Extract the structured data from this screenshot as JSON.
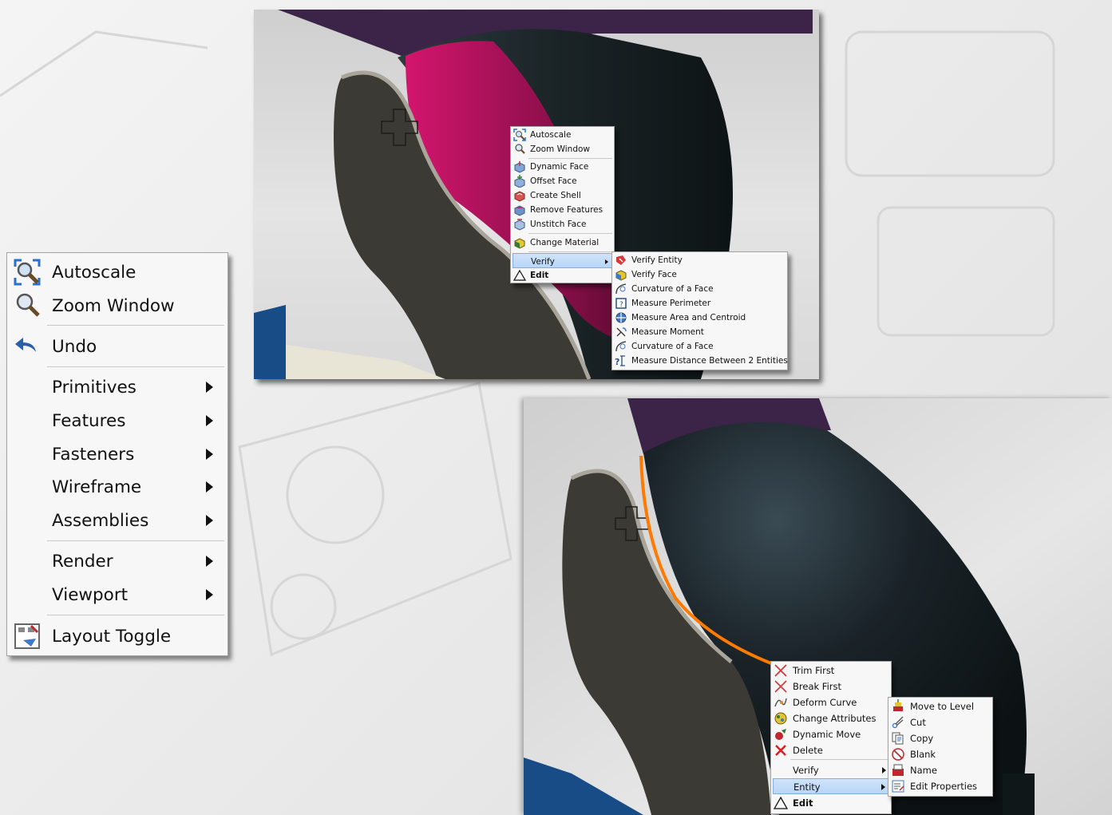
{
  "main_menu": {
    "items": [
      {
        "label": "Autoscale",
        "icon": "autoscale-icon"
      },
      {
        "label": "Zoom Window",
        "icon": "zoom-window-icon"
      },
      {
        "label": "Undo",
        "icon": "undo-icon"
      },
      {
        "label": "Primitives"
      },
      {
        "label": "Features"
      },
      {
        "label": "Fasteners"
      },
      {
        "label": "Wireframe"
      },
      {
        "label": "Assemblies"
      },
      {
        "label": "Render"
      },
      {
        "label": "Viewport"
      },
      {
        "label": "Layout Toggle",
        "icon": "layout-toggle-icon"
      }
    ]
  },
  "face_menu": {
    "items": [
      {
        "label": "Autoscale",
        "icon": "autoscale-icon"
      },
      {
        "label": "Zoom Window",
        "icon": "zoom-window-icon"
      },
      {
        "label": "Dynamic Face",
        "icon": "dynamic-face-icon"
      },
      {
        "label": "Offset Face",
        "icon": "offset-face-icon"
      },
      {
        "label": "Create Shell",
        "icon": "create-shell-icon"
      },
      {
        "label": "Remove Features",
        "icon": "remove-features-icon"
      },
      {
        "label": "Unstitch Face",
        "icon": "unstitch-face-icon"
      },
      {
        "label": "Change Material",
        "icon": "change-material-icon"
      },
      {
        "label": "Verify"
      },
      {
        "label": "Edit",
        "icon": "triangle-icon"
      }
    ]
  },
  "verify_submenu": {
    "items": [
      {
        "label": "Verify Entity",
        "icon": "verify-entity-icon"
      },
      {
        "label": "Verify Face",
        "icon": "verify-face-icon"
      },
      {
        "label": "Curvature of a Face",
        "icon": "curvature-icon"
      },
      {
        "label": "Measure Perimeter",
        "icon": "measure-perimeter-icon"
      },
      {
        "label": "Measure Area and Centroid",
        "icon": "measure-area-icon"
      },
      {
        "label": "Measure Moment",
        "icon": "measure-moment-icon"
      },
      {
        "label": "Curvature of a Face",
        "icon": "curvature-icon"
      },
      {
        "label": "Measure Distance Between 2 Entities",
        "icon": "measure-distance-icon"
      }
    ]
  },
  "curve_menu": {
    "items": [
      {
        "label": "Trim First",
        "icon": "trim-first-icon"
      },
      {
        "label": "Break First",
        "icon": "break-first-icon"
      },
      {
        "label": "Deform Curve",
        "icon": "deform-curve-icon"
      },
      {
        "label": "Change Attributes",
        "icon": "change-attributes-icon"
      },
      {
        "label": "Dynamic Move",
        "icon": "dynamic-move-icon"
      },
      {
        "label": "Delete",
        "icon": "delete-icon"
      },
      {
        "label": "Verify"
      },
      {
        "label": "Entity"
      },
      {
        "label": "Edit",
        "icon": "triangle-icon"
      }
    ]
  },
  "entity_submenu": {
    "items": [
      {
        "label": "Move to Level",
        "icon": "move-to-level-icon"
      },
      {
        "label": "Cut",
        "icon": "cut-icon"
      },
      {
        "label": "Copy",
        "icon": "copy-icon"
      },
      {
        "label": "Blank",
        "icon": "blank-icon"
      },
      {
        "label": "Name",
        "icon": "name-icon"
      },
      {
        "label": "Edit Properties",
        "icon": "edit-properties-icon"
      }
    ]
  },
  "colors": {
    "highlight_face": "#b0125f",
    "selected_curve": "#ff7a00",
    "body": "#1c2528",
    "menu_highlight": "#c3dcf9"
  }
}
